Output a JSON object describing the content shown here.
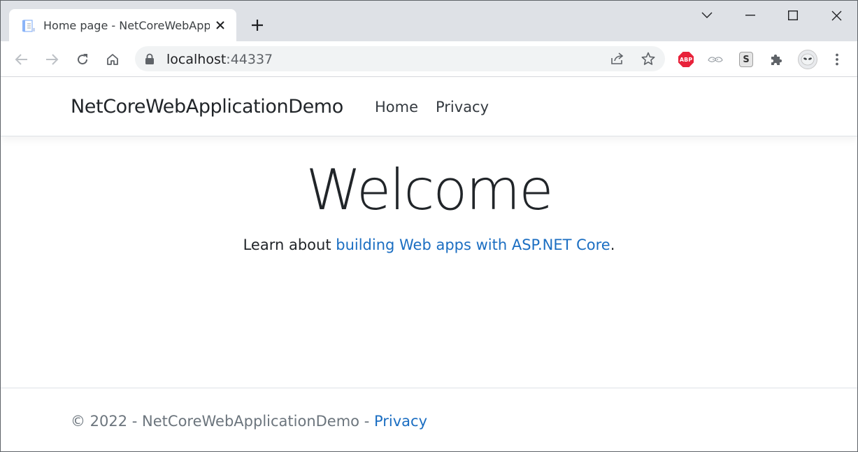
{
  "browser": {
    "tab": {
      "title": "Home page - NetCoreWebApplicationDemo",
      "favicon": "document-icon"
    },
    "address": {
      "host": "localhost",
      "port": ":44337"
    },
    "colors": {
      "tabstrip": "#dee1e6",
      "omnibox": "#f1f3f4",
      "abp": "#e8223a"
    },
    "extensions": {
      "abp_label": "ABP",
      "s_label": "S"
    }
  },
  "navbar": {
    "brand": "NetCoreWebApplicationDemo",
    "links": [
      "Home",
      "Privacy"
    ]
  },
  "main": {
    "heading": "Welcome",
    "learn_prefix": "Learn about ",
    "learn_link": "building Web apps with ASP.NET Core",
    "learn_suffix": "."
  },
  "footer": {
    "text": "© 2022 - NetCoreWebApplicationDemo - ",
    "link": "Privacy"
  },
  "colors": {
    "link": "#1b6ec2",
    "text": "#212529",
    "muted": "#6c757d"
  }
}
